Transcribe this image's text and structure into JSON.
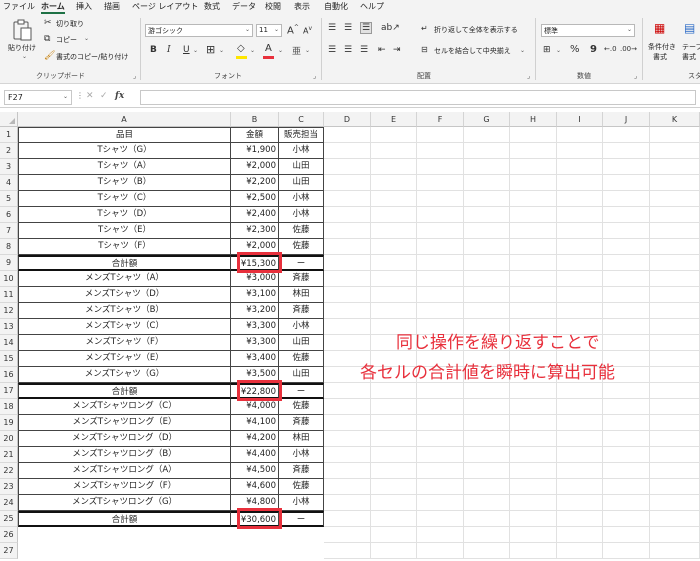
{
  "menu": {
    "tabs": [
      "ファイル",
      "ホーム",
      "挿入",
      "描画",
      "ページ レイアウト",
      "数式",
      "データ",
      "校閲",
      "表示",
      "自動化",
      "ヘルプ"
    ],
    "active": "ホーム"
  },
  "ribbon": {
    "clipboard": {
      "paste": "貼り付け",
      "cut": "切り取り",
      "copy": "コピー",
      "format_painter": "書式のコピー/貼り付け",
      "label": "クリップボード"
    },
    "font": {
      "name": "游ゴシック",
      "size": "11",
      "grow": "A",
      "shrink": "A",
      "bold": "B",
      "italic": "I",
      "underline": "U",
      "font_color": "A",
      "label": "フォント"
    },
    "alignment": {
      "wrap": "折り返して全体を表示する",
      "merge": "セルを結合して中央揃え",
      "label": "配置"
    },
    "number": {
      "format": "標準",
      "percent": "%",
      "comma": "9",
      "label": "数値"
    },
    "styles": {
      "conditional": "条件付き",
      "conditional_2": "書式",
      "table": "テーブ",
      "table_2": "書式",
      "label": "スタ"
    }
  },
  "formula_bar": {
    "cell_ref": "F27",
    "fx": "fx",
    "value": ""
  },
  "columns": [
    "A",
    "B",
    "C",
    "D",
    "E",
    "F",
    "G",
    "H",
    "I",
    "J",
    "K"
  ],
  "table": {
    "headers": [
      "品目",
      "金額",
      "販売担当"
    ],
    "rows": [
      [
        "Tシャツ（G）",
        "¥1,900",
        "小林"
      ],
      [
        "Tシャツ（A）",
        "¥2,000",
        "山田"
      ],
      [
        "Tシャツ（B）",
        "¥2,200",
        "山田"
      ],
      [
        "Tシャツ（C）",
        "¥2,500",
        "小林"
      ],
      [
        "Tシャツ（D）",
        "¥2,400",
        "小林"
      ],
      [
        "Tシャツ（E）",
        "¥2,300",
        "佐藤"
      ],
      [
        "Tシャツ（F）",
        "¥2,000",
        "佐藤"
      ],
      [
        "合計額",
        "¥15,300",
        "ー"
      ],
      [
        "メンズTシャツ（A）",
        "¥3,000",
        "斉藤"
      ],
      [
        "メンズTシャツ（D）",
        "¥3,100",
        "林田"
      ],
      [
        "メンズTシャツ（B）",
        "¥3,200",
        "斉藤"
      ],
      [
        "メンズTシャツ（C）",
        "¥3,300",
        "小林"
      ],
      [
        "メンズTシャツ（F）",
        "¥3,300",
        "山田"
      ],
      [
        "メンズTシャツ（E）",
        "¥3,400",
        "佐藤"
      ],
      [
        "メンズTシャツ（G）",
        "¥3,500",
        "山田"
      ],
      [
        "合計額",
        "¥22,800",
        "ー"
      ],
      [
        "メンズTシャツロング（C）",
        "¥4,000",
        "佐藤"
      ],
      [
        "メンズTシャツロング（E）",
        "¥4,100",
        "斉藤"
      ],
      [
        "メンズTシャツロング（D）",
        "¥4,200",
        "林田"
      ],
      [
        "メンズTシャツロング（B）",
        "¥4,400",
        "小林"
      ],
      [
        "メンズTシャツロング（A）",
        "¥4,500",
        "斉藤"
      ],
      [
        "メンズTシャツロング（F）",
        "¥4,600",
        "佐藤"
      ],
      [
        "メンズTシャツロング（G）",
        "¥4,800",
        "小林"
      ],
      [
        "合計額",
        "¥30,600",
        "ー"
      ]
    ]
  },
  "row_numbers": [
    "1",
    "2",
    "3",
    "4",
    "5",
    "6",
    "7",
    "8",
    "9",
    "10",
    "11",
    "12",
    "13",
    "14",
    "15",
    "16",
    "17",
    "18",
    "19",
    "20",
    "21",
    "22",
    "23",
    "24",
    "25",
    "26",
    "27"
  ],
  "annotation": {
    "line1": "同じ操作を繰り返すことで",
    "line2": "各セルの合計値を瞬時に算出可能"
  },
  "colors": {
    "accent": "#1e7145",
    "highlight": "#e8303c"
  }
}
